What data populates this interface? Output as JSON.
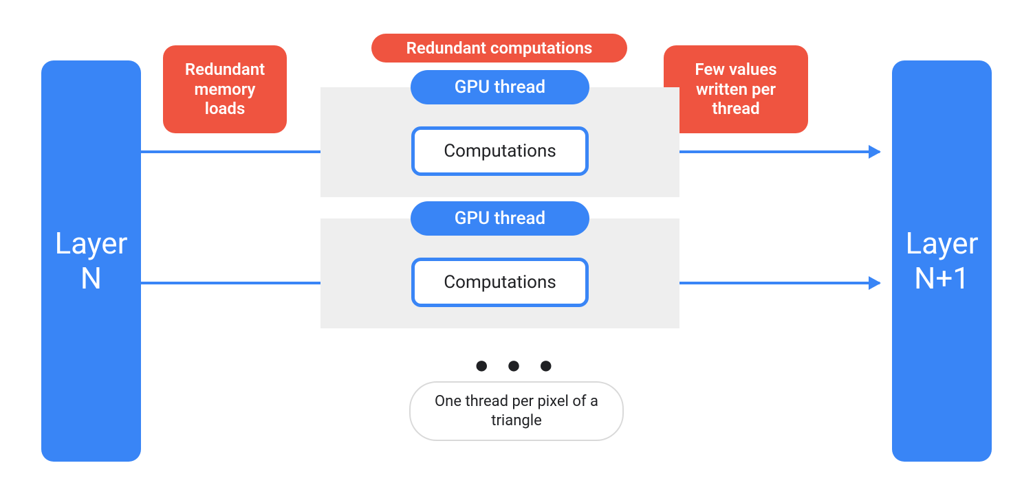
{
  "colors": {
    "blue": "#3985f6",
    "red": "#ef5440",
    "grey": "#eeeeee"
  },
  "layer_left": "Layer\nN",
  "layer_right": "Layer\nN+1",
  "labels": {
    "redundant_computations": "Redundant computations",
    "redundant_memory_loads": "Redundant memory loads",
    "few_values": "Few values written per thread"
  },
  "gpu_thread_label": "GPU thread",
  "computations_label": "Computations",
  "ellipsis": "● ● ●",
  "footnote": "One thread per pixel of a triangle",
  "chart_data": {
    "type": "flow-diagram",
    "nodes": [
      {
        "id": "layerN",
        "label": "Layer N",
        "kind": "layer"
      },
      {
        "id": "thread1",
        "label": "GPU thread",
        "kind": "thread",
        "inner": "Computations"
      },
      {
        "id": "thread2",
        "label": "GPU thread",
        "kind": "thread",
        "inner": "Computations"
      },
      {
        "id": "layerN1",
        "label": "Layer N+1",
        "kind": "layer"
      }
    ],
    "edges": [
      {
        "from": "layerN",
        "to": "thread1",
        "annotation": "Redundant memory loads"
      },
      {
        "from": "layerN",
        "to": "thread2"
      },
      {
        "from": "thread1",
        "to": "layerN1",
        "annotation": "Few values written per thread"
      },
      {
        "from": "thread2",
        "to": "layerN1"
      }
    ],
    "annotations": [
      {
        "text": "Redundant computations",
        "target": "threads"
      },
      {
        "text": "One thread per pixel of a triangle",
        "target": "threads-note"
      }
    ],
    "thread_repetition": "many (ellipsis shown)"
  }
}
